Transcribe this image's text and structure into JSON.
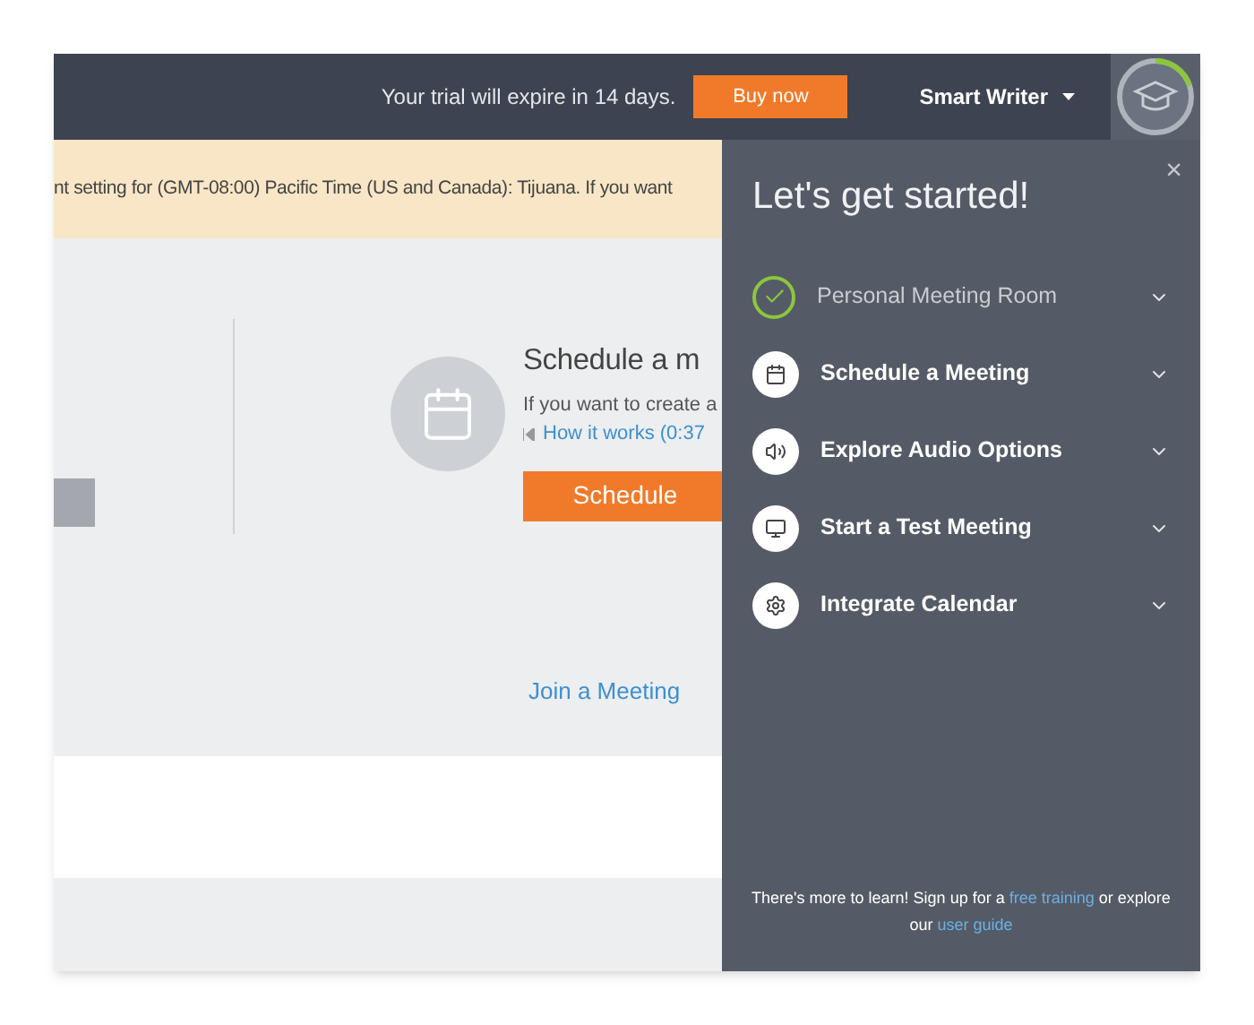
{
  "top_bar": {
    "trial_text": "Your trial will expire in 14 days.",
    "buy_button": "Buy now",
    "account_menu": "Smart Writer",
    "progress": {
      "level": 0.2
    }
  },
  "banner": {
    "text": "nt setting for (GMT-08:00) Pacific Time (US and Canada): Tijuana. If you want"
  },
  "schedule": {
    "heading": "Schedule a m",
    "description": "If you want to create a",
    "video_link": "How it works (0:37",
    "button": "Schedule",
    "join_link": "Join a Meeting"
  },
  "guide": {
    "title": "Let's get started!",
    "close": "×",
    "steps": [
      {
        "label": "Personal Meeting Room",
        "done": true,
        "expanded": false
      },
      {
        "label": "Schedule a Meeting",
        "done": false,
        "expanded": false
      },
      {
        "label": "Explore Audio Options",
        "done": false,
        "expanded": false
      },
      {
        "label": "Start a Test Meeting",
        "done": false,
        "expanded": false
      },
      {
        "label": "Integrate Calendar",
        "done": false,
        "expanded": false
      }
    ],
    "footer": {
      "text": "There's more to learn! Sign up for a",
      "link1": "free training",
      "middle": "or explore our",
      "link2": "user guide"
    }
  }
}
